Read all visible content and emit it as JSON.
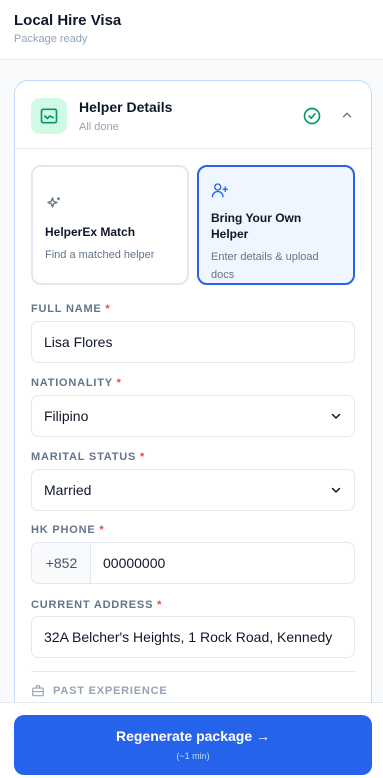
{
  "header": {
    "title": "Local Hire Visa",
    "subtitle": "Package ready"
  },
  "section": {
    "title": "Helper Details",
    "status": "All done",
    "options": [
      {
        "label": "HelperEx Match",
        "desc": "Find a matched helper"
      },
      {
        "label": "Bring Your Own Helper",
        "desc": "Enter details & upload docs"
      }
    ],
    "fields": {
      "full_name": {
        "label": "FULL NAME",
        "value": "Lisa Flores"
      },
      "nationality": {
        "label": "NATIONALITY",
        "value": "Filipino"
      },
      "marital_status": {
        "label": "MARITAL STATUS",
        "value": "Married"
      },
      "hk_phone": {
        "label": "HK PHONE",
        "prefix": "+852",
        "value": "00000000"
      },
      "current_address": {
        "label": "CURRENT ADDRESS",
        "value": "32A Belcher's Heights, 1 Rock Road, Kennedy"
      }
    },
    "past_experience_label": "PAST EXPERIENCE"
  },
  "cta": {
    "label": "Regenerate package →",
    "sublabel": "(~1 min)"
  },
  "colors": {
    "accent": "#2563eb",
    "success": "#059669",
    "required": "#ef4444"
  }
}
